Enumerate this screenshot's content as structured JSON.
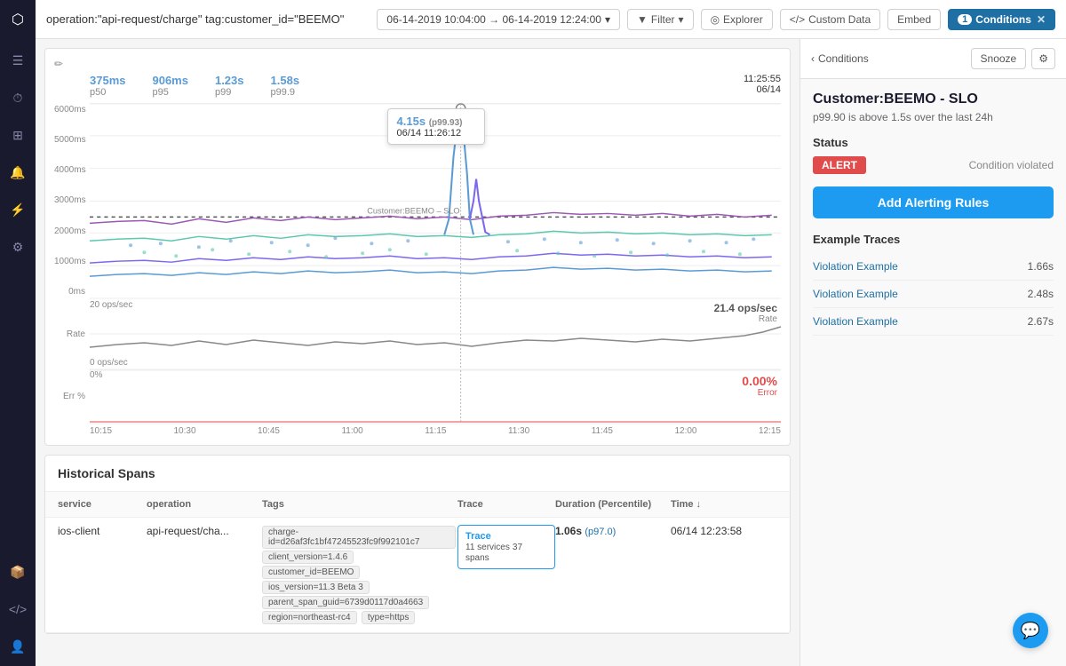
{
  "topbar": {
    "title": "operation:\"api-request/charge\" tag:customer_id=\"BEEMO\"",
    "date_range": "06-14-2019 10:04:00 → 06-14-2019 12:24:00",
    "filter_label": "Filter",
    "explorer_label": "Explorer",
    "custom_data_label": "Custom Data",
    "embed_label": "Embed",
    "conditions_label": "Conditions",
    "conditions_count": "1"
  },
  "sidebar": {
    "icons": [
      "⬡",
      "☰",
      "⏱",
      "⊞",
      "🔔",
      "⚡",
      "⚙"
    ]
  },
  "percentiles": {
    "p50": {
      "value": "375ms",
      "label": "p50"
    },
    "p95": {
      "value": "906ms",
      "label": "p95"
    },
    "p99": {
      "value": "1.23s",
      "label": "p99"
    },
    "p999": {
      "value": "1.58s",
      "label": "p99.9"
    },
    "datetime": "11:25:55\n06/14"
  },
  "tooltip": {
    "value": "4.15s",
    "percentile": "(p99.93)",
    "datetime": "06/14 11:26:12"
  },
  "chart": {
    "slo_label": "Customer:BEEMO – SLO",
    "rate_value": "21.4 ops/sec",
    "rate_label": "Rate",
    "error_value": "0.00%",
    "error_label": "Error",
    "y_labels_latency": [
      "6000ms",
      "5000ms",
      "4000ms",
      "3000ms",
      "2000ms",
      "1000ms",
      "0ms"
    ],
    "y_labels_rate": [
      "20 ops/sec",
      "0 ops/sec"
    ],
    "y_labels_error": [
      "0%"
    ],
    "x_labels": [
      "10:15",
      "10:30",
      "10:45",
      "11:00",
      "11:15",
      "11:30",
      "11:45",
      "12:00",
      "12:15"
    ]
  },
  "right_panel": {
    "back_label": "Conditions",
    "snooze_label": "Snooze",
    "slo_title": "Customer:BEEMO - SLO",
    "slo_subtitle": "p99.90 is above 1.5s over the last 24h",
    "status_label": "Status",
    "alert_badge": "ALERT",
    "condition_text": "Condition violated",
    "add_alerting_label": "Add Alerting Rules",
    "example_traces_title": "Example Traces",
    "traces": [
      {
        "label": "Violation Example",
        "duration": "1.66s"
      },
      {
        "label": "Violation Example",
        "duration": "2.48s"
      },
      {
        "label": "Violation Example",
        "duration": "2.67s"
      }
    ]
  },
  "historical_spans": {
    "title": "Historical Spans",
    "columns": [
      "service",
      "operation",
      "Tags",
      "Trace",
      "Duration (Percentile)",
      "Time ↓"
    ],
    "rows": [
      {
        "service": "ios-client",
        "operation": "api-request/cha...",
        "tags": [
          "charge-id=d26af3fc1bf47245523fc9f992101c7",
          "client_version=1.4.6",
          "customer_id=BEEMO",
          "ios_version=11.3 Beta 3",
          "parent_span_guid=6739d0117d0a4663",
          "region=northeast-rc4",
          "type=https"
        ],
        "trace_link": "Trace",
        "trace_services": "11 services",
        "trace_spans": "37 spans",
        "duration": "1.06s",
        "duration_pct": "(p97.0)",
        "time": "06/14 12:23:58"
      }
    ]
  },
  "chat_icon": "💬"
}
